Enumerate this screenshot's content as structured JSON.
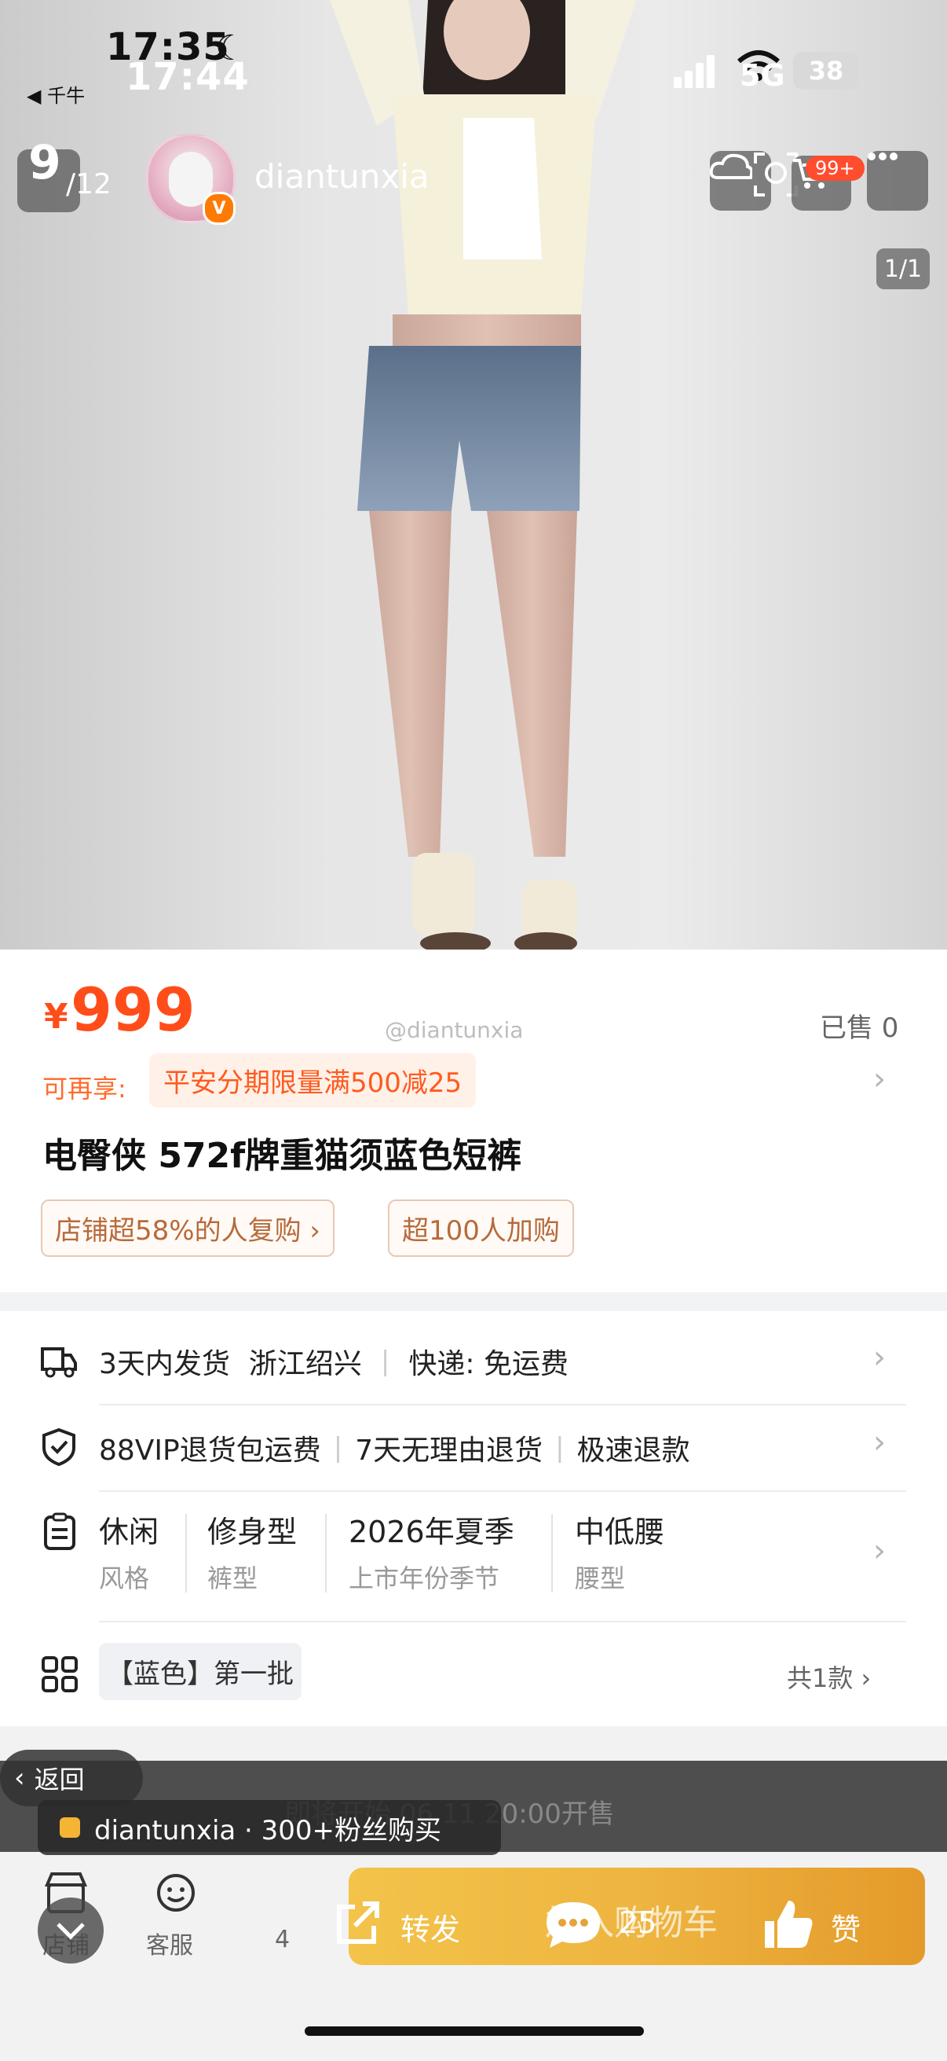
{
  "status_bar": {
    "time_behind": "17:35",
    "time": "17:44",
    "back_app": "◀ 千牛",
    "network": "5G",
    "battery": "38"
  },
  "header": {
    "page_current": "9",
    "page_total": "/12",
    "username": "diantunxia",
    "cart_badge": "99+",
    "image_index": "1/1"
  },
  "product": {
    "currency": "¥",
    "price": "999",
    "sold": "已售 0",
    "watermark": "@diantunxia",
    "promo_label": "可再享:",
    "promo_chip": "平安分期限量满500减25",
    "title": "电臀侠 572f牌重猫须蓝色短裤",
    "tags": [
      "店铺超58%的人复购 ›",
      "超100人加购"
    ]
  },
  "shipping": {
    "days": "3天内发货",
    "origin": "浙江绍兴",
    "express": "快递: 免运费"
  },
  "service": {
    "items": [
      "88VIP退货包运费",
      "7天无理由退货",
      "极速退款"
    ]
  },
  "attributes": [
    {
      "value": "休闲",
      "label": "风格"
    },
    {
      "value": "修身型",
      "label": "裤型"
    },
    {
      "value": "2026年夏季",
      "label": "上市年份季节"
    },
    {
      "value": "中低腰",
      "label": "腰型"
    }
  ],
  "sku": {
    "chip": "【蓝色】第一批",
    "count": "共1款 ›"
  },
  "overlay": {
    "back": "返回",
    "presale": "即将开始  06.11 20:00开售",
    "fans": "diantunxia · 300+粉丝购买"
  },
  "bottom_nav": {
    "shop": "店铺",
    "service": "客服",
    "count": "4",
    "cart_button": "加入购物车",
    "share": "转发",
    "comments": "25",
    "like": "赞"
  },
  "colors": {
    "accent": "#ff4d1a",
    "cart_button": "#eeb540"
  }
}
